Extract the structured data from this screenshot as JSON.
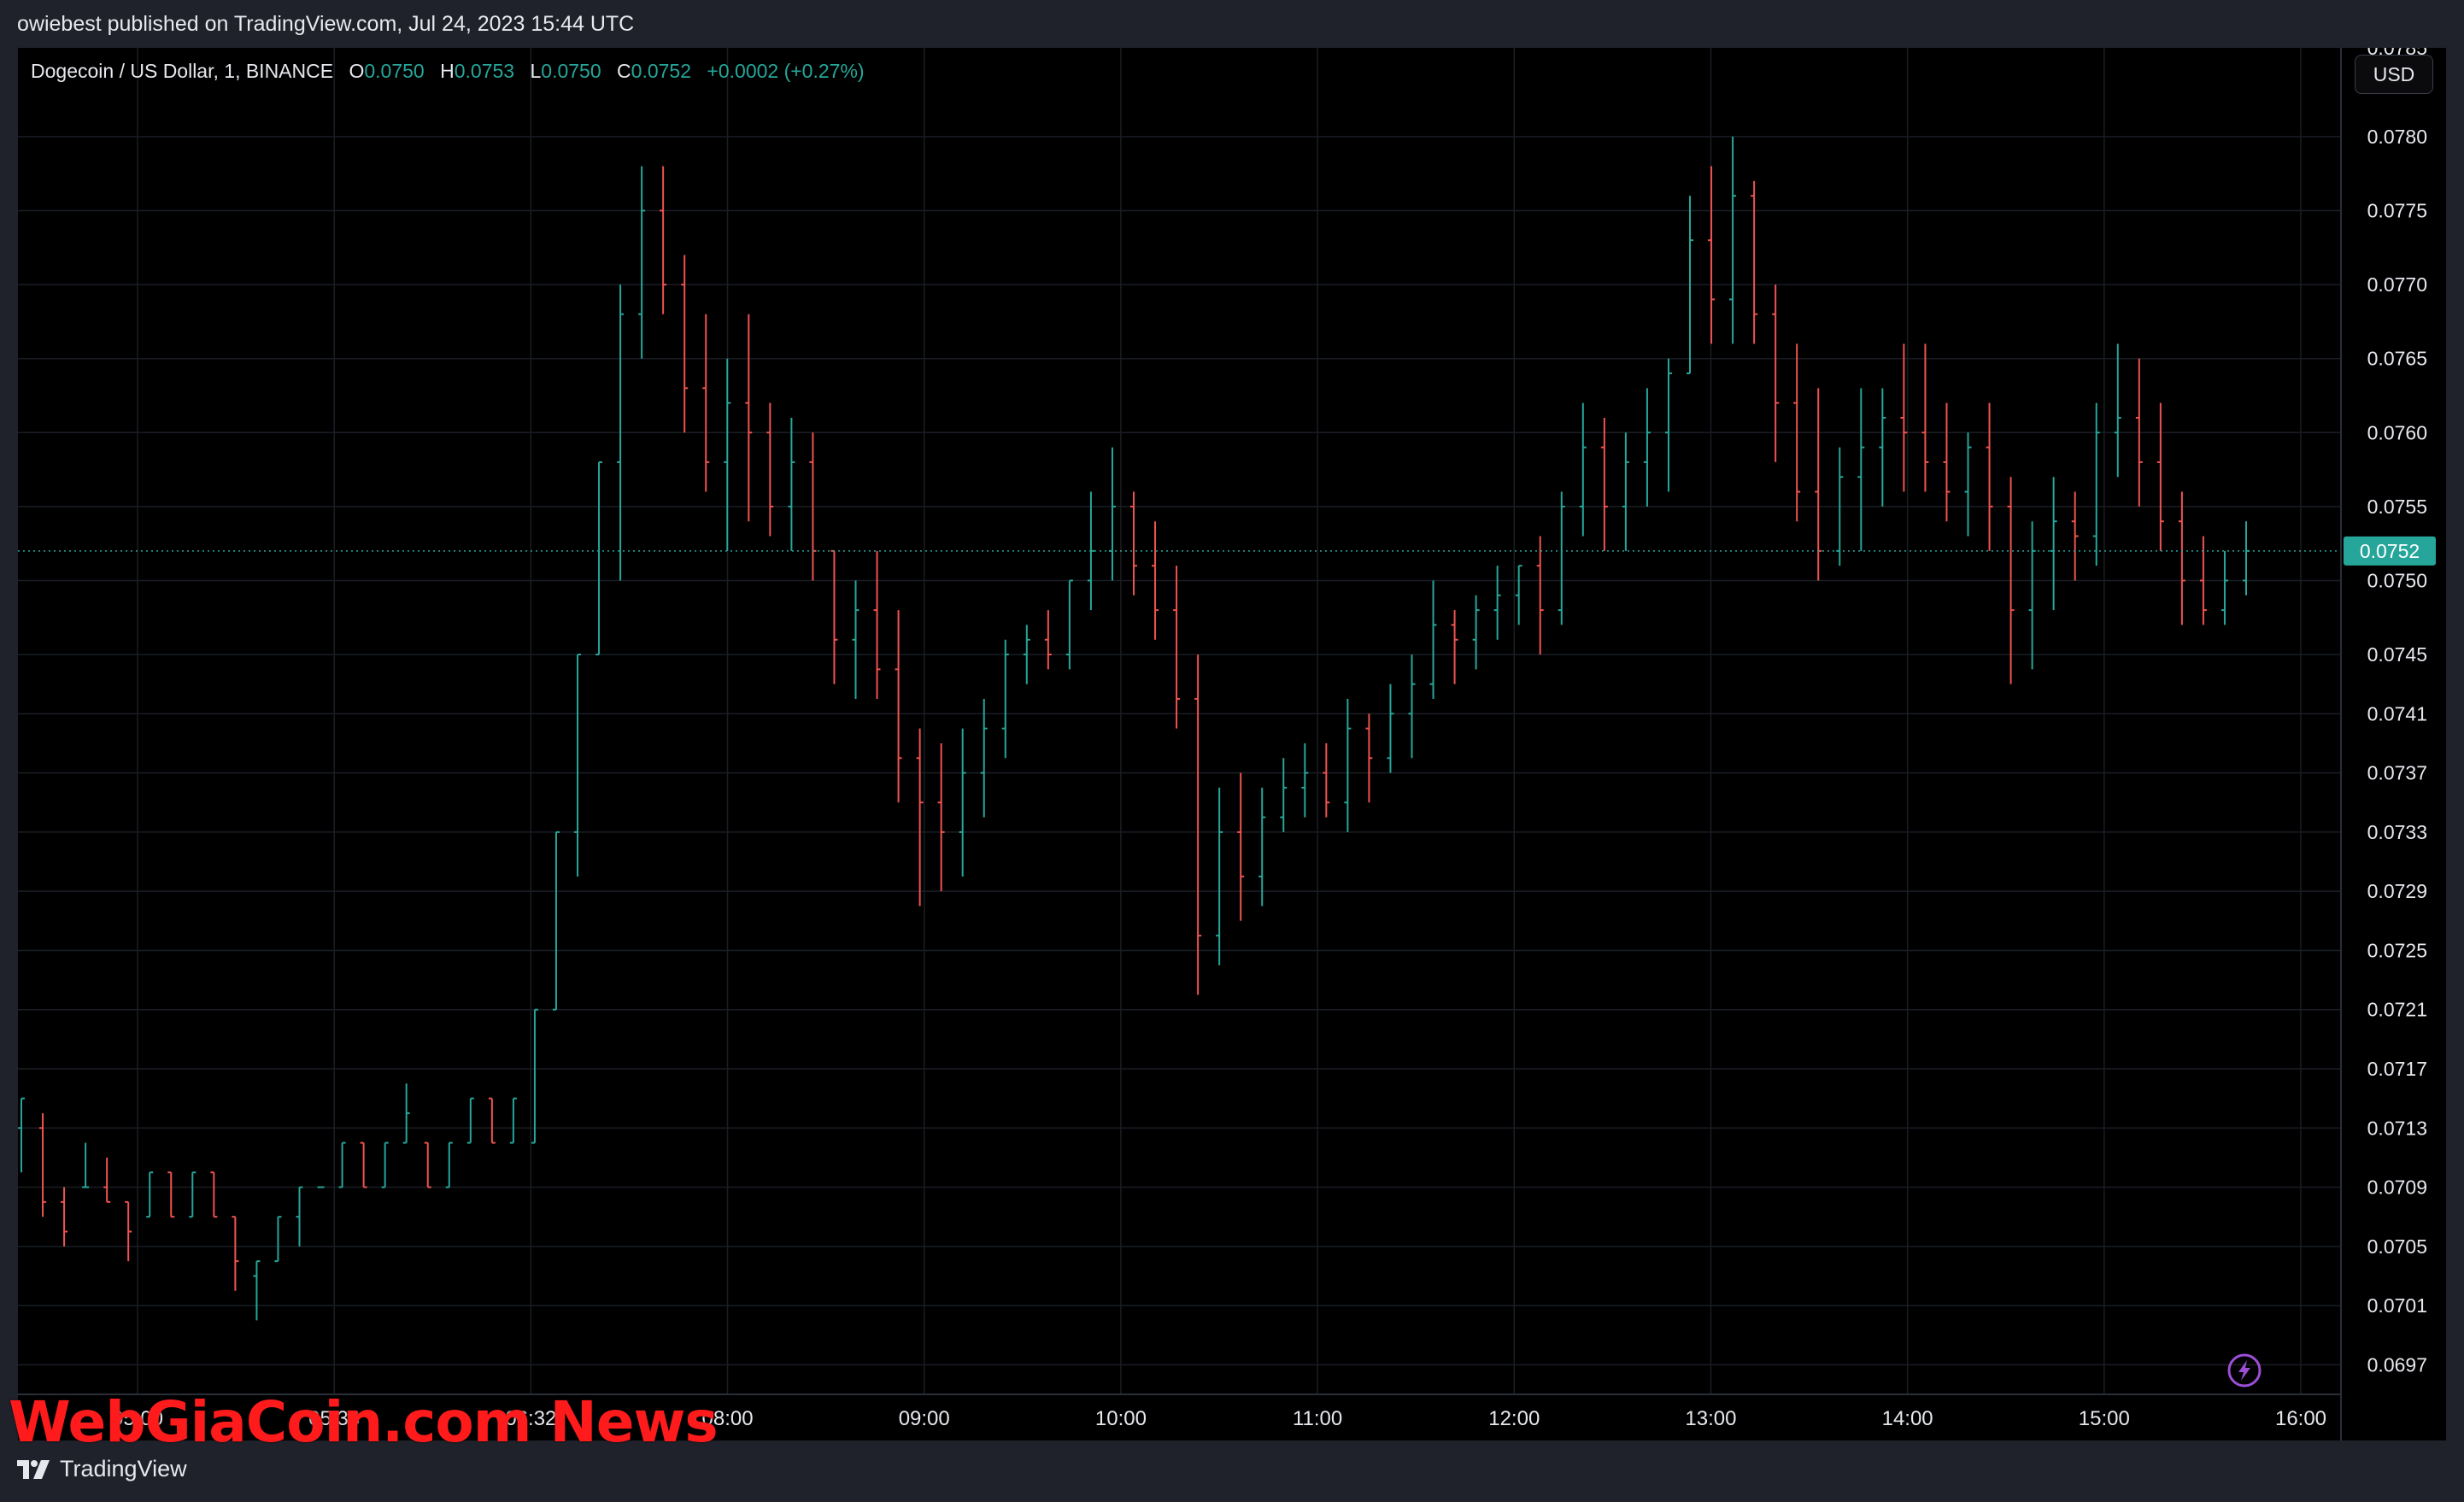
{
  "header": {
    "published_by": "owiebest published on TradingView.com, Jul 24, 2023 15:44 UTC"
  },
  "legend": {
    "symbol": "Dogecoin / US Dollar, 1, BINANCE",
    "o_label": "O",
    "o_value": "0.0750",
    "h_label": "H",
    "h_value": "0.0753",
    "l_label": "L",
    "l_value": "0.0750",
    "c_label": "C",
    "c_value": "0.0752",
    "change": "+0.0002 (+0.27%)"
  },
  "currency_button": "USD",
  "watermark": "WebGiaCoin.com News",
  "footer": {
    "brand": "TradingView"
  },
  "colors": {
    "up": "#26a69a",
    "down": "#ef5350",
    "price_line": "#26a69a",
    "grid": "#1a1d24"
  },
  "chart_data": {
    "type": "bar",
    "title": "Dogecoin / US Dollar, 1, BINANCE",
    "xlabel": "",
    "ylabel": "",
    "ylim": [
      0.0695,
      0.0786
    ],
    "y_ticks": [
      "0.0780",
      "0.0775",
      "0.0770",
      "0.0765",
      "0.0760",
      "0.0755",
      "0.0750",
      "0.0745",
      "0.0741",
      "0.0737",
      "0.0733",
      "0.0729",
      "0.0725",
      "0.0721",
      "0.0717",
      "0.0713",
      "0.0709",
      "0.0705",
      "0.0701",
      "0.0697"
    ],
    "y_tick_top_partial": "0.0785",
    "x_ticks": [
      "05:00",
      "05:33",
      "06:32",
      "08:00",
      "09:00",
      "10:00",
      "11:00",
      "12:00",
      "13:00",
      "14:00",
      "15:00",
      "16:00"
    ],
    "last_price": "0.0752",
    "grid": true,
    "series": [
      {
        "values": [
          [
            0.0713,
            0.0715,
            0.071,
            0.0715
          ],
          [
            0.0713,
            0.0714,
            0.0707,
            0.0708
          ],
          [
            0.0708,
            0.0709,
            0.0705,
            0.0706
          ],
          [
            0.0709,
            0.0712,
            0.0709,
            0.0709
          ],
          [
            0.0709,
            0.0711,
            0.0708,
            0.0708
          ],
          [
            0.0708,
            0.0708,
            0.0704,
            0.0706
          ],
          [
            0.0707,
            0.071,
            0.0707,
            0.071
          ],
          [
            0.071,
            0.071,
            0.0707,
            0.0707
          ],
          [
            0.0707,
            0.071,
            0.0707,
            0.071
          ],
          [
            0.071,
            0.071,
            0.0707,
            0.0707
          ],
          [
            0.0707,
            0.0707,
            0.0702,
            0.0704
          ],
          [
            0.0703,
            0.07,
            0.0704,
            0.0704
          ],
          [
            0.0704,
            0.0707,
            0.0704,
            0.0707
          ],
          [
            0.0707,
            0.0709,
            0.0705,
            0.0709
          ],
          [
            0.0709,
            0.0709,
            0.0709,
            0.0709
          ],
          [
            0.0709,
            0.0712,
            0.0709,
            0.0712
          ],
          [
            0.0712,
            0.0712,
            0.0709,
            0.0709
          ],
          [
            0.0709,
            0.0712,
            0.0709,
            0.0712
          ],
          [
            0.0712,
            0.0716,
            0.0712,
            0.0714
          ],
          [
            0.0712,
            0.0712,
            0.0709,
            0.0709
          ],
          [
            0.0709,
            0.0712,
            0.0709,
            0.0712
          ],
          [
            0.0712,
            0.0715,
            0.0712,
            0.0715
          ],
          [
            0.0715,
            0.0715,
            0.0712,
            0.0712
          ],
          [
            0.0712,
            0.0715,
            0.0712,
            0.0715
          ],
          [
            0.0712,
            0.0721,
            0.0712,
            0.0721
          ],
          [
            0.0721,
            0.0733,
            0.0721,
            0.0733
          ],
          [
            0.0733,
            0.0745,
            0.073,
            0.0745
          ],
          [
            0.0745,
            0.0758,
            0.0745,
            0.0758
          ],
          [
            0.0758,
            0.077,
            0.075,
            0.0768
          ],
          [
            0.0768,
            0.0778,
            0.0765,
            0.0775
          ],
          [
            0.0775,
            0.0778,
            0.0768,
            0.077
          ],
          [
            0.077,
            0.0772,
            0.076,
            0.0763
          ],
          [
            0.0763,
            0.0768,
            0.0756,
            0.0758
          ],
          [
            0.0758,
            0.0765,
            0.0752,
            0.0762
          ],
          [
            0.0762,
            0.0768,
            0.0754,
            0.076
          ],
          [
            0.076,
            0.0762,
            0.0753,
            0.0755
          ],
          [
            0.0755,
            0.0761,
            0.0752,
            0.0758
          ],
          [
            0.0758,
            0.076,
            0.075,
            0.0752
          ],
          [
            0.0752,
            0.0752,
            0.0743,
            0.0746
          ],
          [
            0.0746,
            0.075,
            0.0742,
            0.0748
          ],
          [
            0.0748,
            0.0752,
            0.0742,
            0.0744
          ],
          [
            0.0744,
            0.0748,
            0.0735,
            0.0738
          ],
          [
            0.0738,
            0.074,
            0.0728,
            0.0735
          ],
          [
            0.0735,
            0.0739,
            0.0729,
            0.0733
          ],
          [
            0.0733,
            0.074,
            0.073,
            0.0737
          ],
          [
            0.0737,
            0.0742,
            0.0734,
            0.074
          ],
          [
            0.074,
            0.0746,
            0.0738,
            0.0745
          ],
          [
            0.0745,
            0.0747,
            0.0743,
            0.0746
          ],
          [
            0.0746,
            0.0748,
            0.0744,
            0.0745
          ],
          [
            0.0745,
            0.075,
            0.0744,
            0.075
          ],
          [
            0.075,
            0.0756,
            0.0748,
            0.0752
          ],
          [
            0.0752,
            0.0759,
            0.075,
            0.0755
          ],
          [
            0.0755,
            0.0756,
            0.0749,
            0.0751
          ],
          [
            0.0751,
            0.0754,
            0.0746,
            0.0748
          ],
          [
            0.0748,
            0.0751,
            0.074,
            0.0742
          ],
          [
            0.0742,
            0.0745,
            0.0722,
            0.0726
          ],
          [
            0.0726,
            0.0736,
            0.0724,
            0.0733
          ],
          [
            0.0733,
            0.0737,
            0.0727,
            0.073
          ],
          [
            0.073,
            0.0736,
            0.0728,
            0.0734
          ],
          [
            0.0734,
            0.0738,
            0.0733,
            0.0736
          ],
          [
            0.0736,
            0.0739,
            0.0734,
            0.0737
          ],
          [
            0.0737,
            0.0739,
            0.0734,
            0.0735
          ],
          [
            0.0735,
            0.0742,
            0.0733,
            0.074
          ],
          [
            0.074,
            0.0741,
            0.0735,
            0.0738
          ],
          [
            0.0738,
            0.0743,
            0.0737,
            0.0741
          ],
          [
            0.0741,
            0.0745,
            0.0738,
            0.0743
          ],
          [
            0.0743,
            0.075,
            0.0742,
            0.0747
          ],
          [
            0.0747,
            0.0748,
            0.0743,
            0.0746
          ],
          [
            0.0746,
            0.0749,
            0.0744,
            0.0748
          ],
          [
            0.0748,
            0.0751,
            0.0746,
            0.0749
          ],
          [
            0.0749,
            0.0751,
            0.0747,
            0.0751
          ],
          [
            0.0751,
            0.0753,
            0.0745,
            0.0748
          ],
          [
            0.0748,
            0.0756,
            0.0747,
            0.0755
          ],
          [
            0.0755,
            0.0762,
            0.0753,
            0.0759
          ],
          [
            0.0759,
            0.0761,
            0.0752,
            0.0755
          ],
          [
            0.0755,
            0.076,
            0.0752,
            0.0758
          ],
          [
            0.0758,
            0.0763,
            0.0755,
            0.076
          ],
          [
            0.076,
            0.0765,
            0.0756,
            0.0764
          ],
          [
            0.0764,
            0.0776,
            0.0764,
            0.0773
          ],
          [
            0.0773,
            0.0778,
            0.0766,
            0.0769
          ],
          [
            0.0769,
            0.078,
            0.0766,
            0.0776
          ],
          [
            0.0776,
            0.0777,
            0.0766,
            0.0768
          ],
          [
            0.0768,
            0.077,
            0.0758,
            0.0762
          ],
          [
            0.0762,
            0.0766,
            0.0754,
            0.0756
          ],
          [
            0.0756,
            0.0763,
            0.075,
            0.0752
          ],
          [
            0.0752,
            0.0759,
            0.0751,
            0.0757
          ],
          [
            0.0757,
            0.0763,
            0.0752,
            0.0759
          ],
          [
            0.0759,
            0.0763,
            0.0755,
            0.0761
          ],
          [
            0.0761,
            0.0766,
            0.0756,
            0.076
          ],
          [
            0.076,
            0.0766,
            0.0756,
            0.0758
          ],
          [
            0.0758,
            0.0762,
            0.0754,
            0.0756
          ],
          [
            0.0756,
            0.076,
            0.0753,
            0.0759
          ],
          [
            0.0759,
            0.0762,
            0.0752,
            0.0755
          ],
          [
            0.0755,
            0.0757,
            0.0743,
            0.0748
          ],
          [
            0.0748,
            0.0754,
            0.0744,
            0.0752
          ],
          [
            0.0752,
            0.0757,
            0.0748,
            0.0754
          ],
          [
            0.0754,
            0.0756,
            0.075,
            0.0753
          ],
          [
            0.0753,
            0.0762,
            0.0751,
            0.076
          ],
          [
            0.076,
            0.0766,
            0.0757,
            0.0761
          ],
          [
            0.0761,
            0.0765,
            0.0755,
            0.0758
          ],
          [
            0.0758,
            0.0762,
            0.0752,
            0.0754
          ],
          [
            0.0754,
            0.0756,
            0.0747,
            0.075
          ],
          [
            0.075,
            0.0753,
            0.0747,
            0.0748
          ],
          [
            0.0748,
            0.0752,
            0.0747,
            0.075
          ],
          [
            0.075,
            0.0754,
            0.0749,
            0.0752
          ]
        ]
      }
    ]
  }
}
